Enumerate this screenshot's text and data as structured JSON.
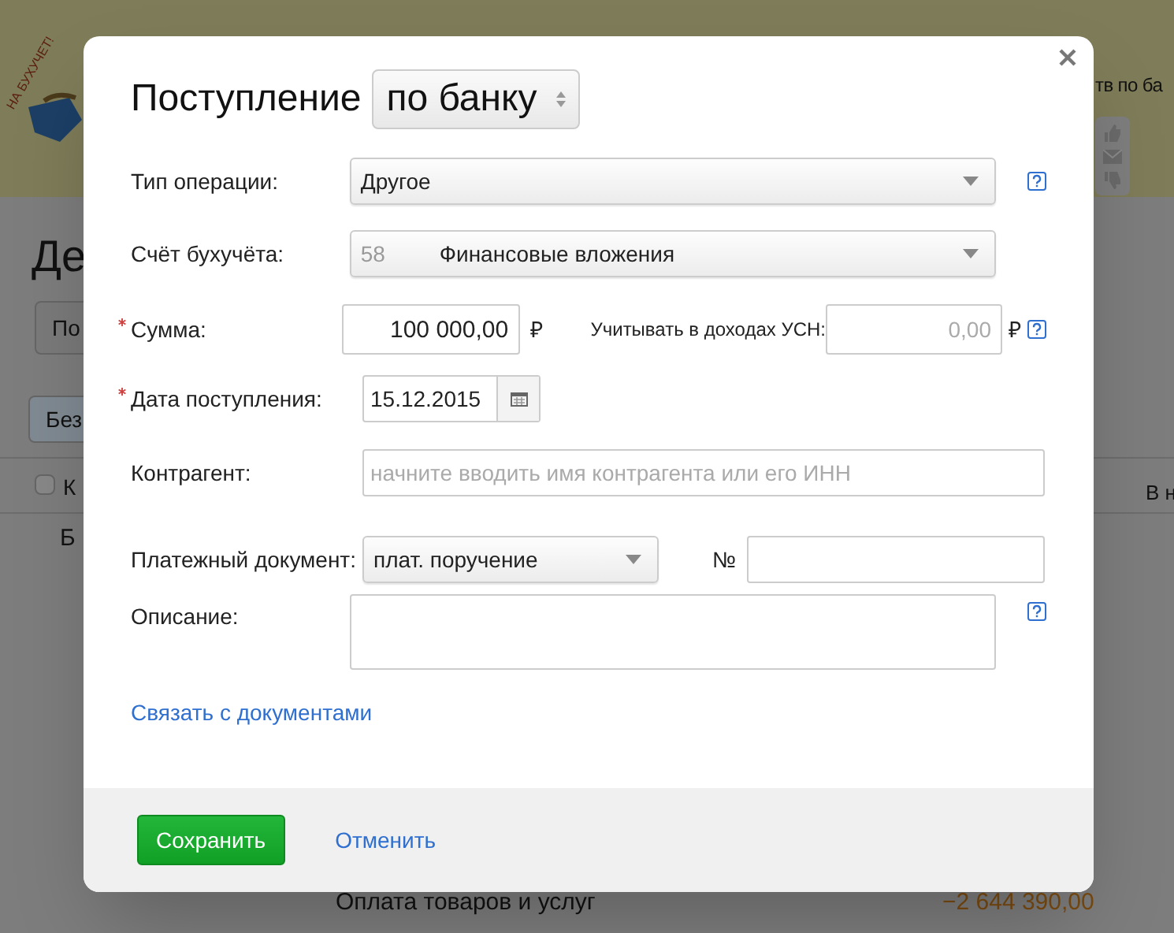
{
  "background": {
    "logo_text": "НА БУХУЧЕТ!",
    "banner_text": "тв по ба",
    "heading": "Де",
    "button": "По",
    "filter": "Без",
    "checkbox_checked": false,
    "column_1": "К",
    "column_2": "В н",
    "row_label": "Б",
    "operation": "Оплата товаров и услуг",
    "amount": "−2 644 390,00"
  },
  "dialog": {
    "title": "Поступление",
    "type_select": "по банку",
    "operation_type": {
      "label": "Тип операции:",
      "value": "Другое",
      "required": false,
      "help": true
    },
    "account": {
      "label": "Счёт бухучёта:",
      "code": "58",
      "value": "Финансовые вложения",
      "required": false,
      "help": false
    },
    "amount": {
      "label": "Сумма:",
      "value": "100 000,00",
      "currency": "₽",
      "required": true,
      "extra_label": "Учитывать в доходах УСН:",
      "extra_placeholder": "0,00",
      "extra_currency": "₽",
      "help": true
    },
    "date": {
      "label": "Дата поступления:",
      "value": "15.12.2015",
      "required": true
    },
    "contractor": {
      "label": "Контрагент:",
      "placeholder": "начните вводить имя контрагента или его ИНН",
      "required": false
    },
    "payment_document": {
      "label": "Платежный документ:",
      "value": "плат. поручение",
      "number_label": "№",
      "required": false
    },
    "description": {
      "label": "Описание:",
      "required": false,
      "help": true
    },
    "link": "Связать с документами",
    "buttons": [
      {
        "label": "Сохранить",
        "kind": "primary"
      },
      {
        "label": "Отменить",
        "kind": "link"
      }
    ]
  }
}
